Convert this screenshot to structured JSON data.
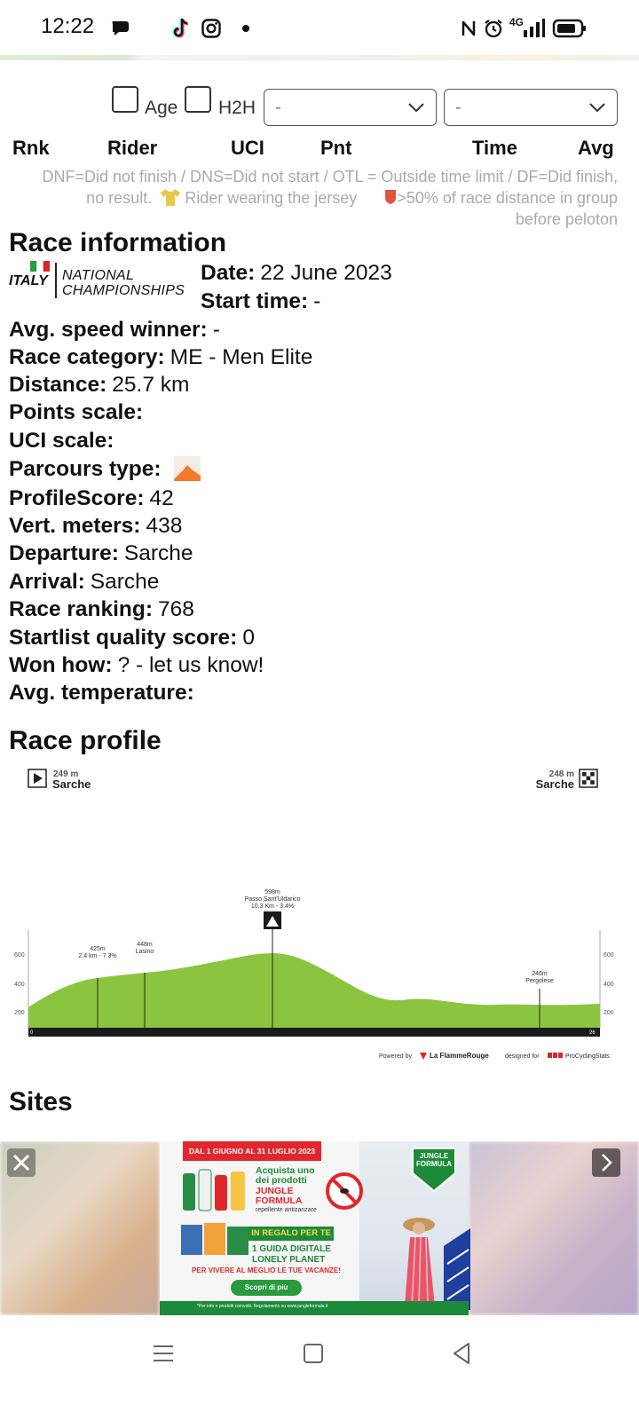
{
  "status_bar": {
    "time": "12:22",
    "network": "4G"
  },
  "filters": {
    "age_label": "Age",
    "h2h_label": "H2H",
    "select1_value": "-",
    "select2_value": "-"
  },
  "results_table": {
    "columns": [
      "Rnk",
      "Rider",
      "UCI",
      "Pnt",
      "Time",
      "Avg"
    ],
    "legend_part1": "DNF=Did not finish / DNS=Did not start / OTL = Outside time limit / DF=Did finish, no result.",
    "legend_jersey": "Rider wearing the jersey",
    "legend_breakaway": ">50% of race distance in group before peloton"
  },
  "race_info": {
    "heading": "Race information",
    "logo_country": "ITALY",
    "logo_line1": "NATIONAL",
    "logo_line2": "CHAMPIONSHIPS",
    "date_label": "Date:",
    "date_value": "22 June 2023",
    "start_label": "Start time:",
    "start_value": "-",
    "rows": [
      {
        "label": "Avg. speed winner:",
        "value": "-"
      },
      {
        "label": "Race category:",
        "value": "ME - Men Elite"
      },
      {
        "label": "Distance:",
        "value": "25.7 km"
      },
      {
        "label": "Points scale:",
        "value": ""
      },
      {
        "label": "UCI scale:",
        "value": ""
      },
      {
        "label": "Parcours type:",
        "value": ""
      },
      {
        "label": "ProfileScore:",
        "value": "42"
      },
      {
        "label": "Vert. meters:",
        "value": "438"
      },
      {
        "label": "Departure:",
        "value": "Sarche"
      },
      {
        "label": "Arrival:",
        "value": "Sarche"
      },
      {
        "label": "Race ranking:",
        "value": "768"
      },
      {
        "label": "Startlist quality score:",
        "value": "0"
      },
      {
        "label": "Won how:",
        "value": "? - let us know!"
      },
      {
        "label": "Avg. temperature:",
        "value": ""
      }
    ]
  },
  "race_profile": {
    "heading": "Race profile",
    "start": {
      "alt": "249 m",
      "name": "Sarche"
    },
    "finish": {
      "alt": "248 m",
      "name": "Sarche"
    },
    "summit": {
      "alt": "598m",
      "name": "Passo Sant'Uldarico",
      "detail": "10.3 Km - 3.4%"
    },
    "point1": {
      "alt": "425m",
      "detail": "2.4 km - 7.3%"
    },
    "point2": {
      "alt": "448m",
      "name": "Lasino"
    },
    "point3": {
      "alt": "246m",
      "name": "Pergolese"
    },
    "y_ticks": [
      "600",
      "400",
      "200"
    ],
    "x_start": "0",
    "x_end": "26",
    "powered_by": "Powered by",
    "brand": "La FlammeRouge",
    "designed_for": "designed for",
    "brand2": "ProCyclingStats",
    "profile_color": "#8bc53f"
  },
  "sites": {
    "heading": "Sites"
  },
  "ad": {
    "banner_date": "DAL 1 GIUGNO AL 31 LUGLIO 2023",
    "brand": "JUNGLE FORMULA",
    "line1": "Acquista uno dei prodotti",
    "line2": "JUNGLE FORMULA",
    "line3": "repellente antizanzare",
    "gift": "IN REGALO PER TE",
    "guide1": "1 GUIDA DIGITALE",
    "guide2": "LONELY PLANET",
    "tagline": "PER VIVERE AL MEGLIO LE TUE VACANZE!",
    "cta": "Scopri di più",
    "footer": "*Per info e prodotti coinvolti. Regolamento su www.jungleformula.it"
  }
}
